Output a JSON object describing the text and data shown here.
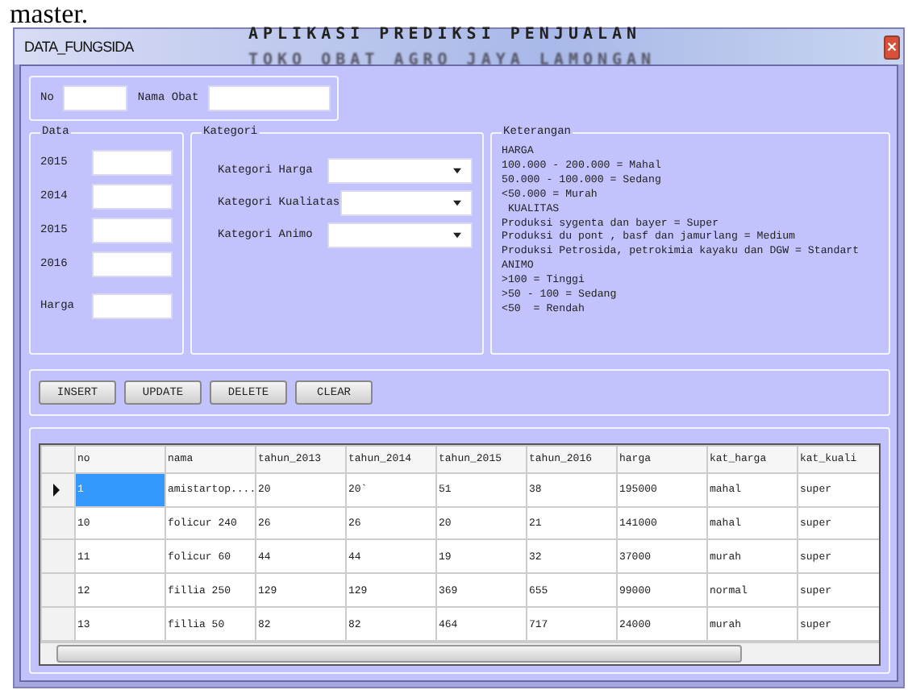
{
  "document_text": "master.",
  "banner": [
    "APLIKASI PREDIKSI PENJUALAN",
    "TOKO OBAT AGRO JAYA LAMONGAN"
  ],
  "window": {
    "title": "DATA_FUNGSIDA"
  },
  "identity_fields": [
    {
      "label": "No"
    },
    {
      "label": "Nama Obat"
    }
  ],
  "data_group": {
    "title": "Data",
    "fields": [
      "2015",
      "2014",
      "2015",
      "2016",
      "Harga"
    ]
  },
  "kategori_group": {
    "title": "Kategori",
    "fields": [
      "Kategori Harga",
      "Kategori Kualiatas",
      "Kategori Animo"
    ]
  },
  "keterangan_group": {
    "title": "Keterangan",
    "lines": [
      "HARGA",
      "100.000 - 200.000 = Mahal",
      "50.000 - 100.000 = Sedang",
      "<50.000 = Murah",
      " KUALITAS",
      "Produksi sygenta dan bayer = Super",
      "Produksi du pont , basf dan jamurlang = Medium",
      "Produksi Petrosida, petrokimia kayaku dan DGW = Standart",
      "ANIMO",
      ">100 = Tinggi",
      ">50 - 100 = Sedang",
      "<50  = Rendah"
    ]
  },
  "buttons": [
    "INSERT",
    "UPDATE",
    "DELETE",
    "CLEAR"
  ],
  "table": {
    "columns": [
      "no",
      "nama",
      "tahun_2013",
      "tahun_2014",
      "tahun_2015",
      "tahun_2016",
      "harga",
      "kat_harga",
      "kat_kuali"
    ],
    "rows": [
      {
        "selected": true,
        "cells": [
          "1",
          "amistartop....",
          "20",
          "20`",
          "51",
          "38",
          "195000",
          "mahal",
          "super"
        ]
      },
      {
        "selected": false,
        "cells": [
          "10",
          "folicur 240",
          "26",
          "26",
          "20",
          "21",
          "141000",
          "mahal",
          "super"
        ]
      },
      {
        "selected": false,
        "cells": [
          "11",
          "folicur 60",
          "44",
          "44",
          "19",
          "32",
          "37000",
          "murah",
          "super"
        ]
      },
      {
        "selected": false,
        "cells": [
          "12",
          "fillia 250",
          "129",
          "129",
          "369",
          "655",
          "99000",
          "normal",
          "super"
        ]
      },
      {
        "selected": false,
        "cells": [
          "13",
          "fillia 50",
          "82",
          "82",
          "464",
          "717",
          "24000",
          "murah",
          "super"
        ]
      }
    ]
  }
}
